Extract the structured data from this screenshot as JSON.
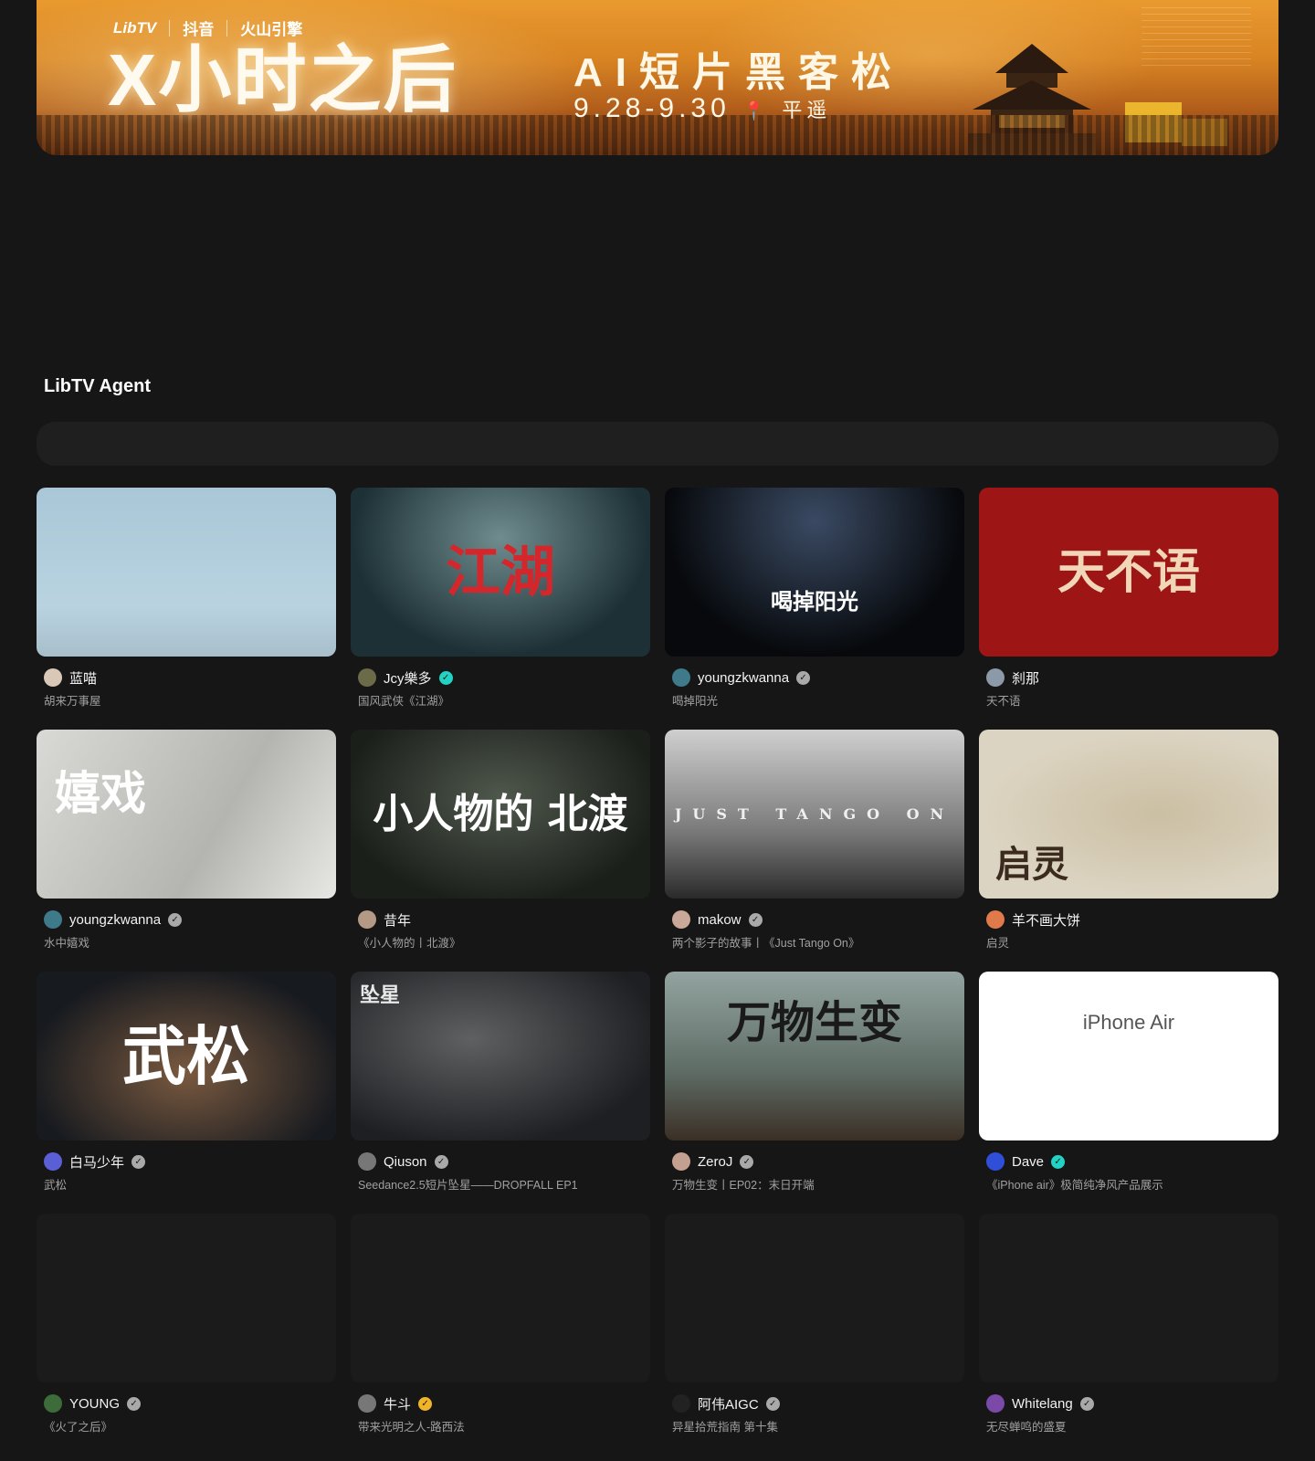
{
  "banner": {
    "brand_libtv": "LibTV",
    "brand_douyin": "抖音",
    "brand_volc": "火山引擎",
    "headline": "X小时之后",
    "subtitle": "AI短片黑客松",
    "dates": "9.28-9.30",
    "location": "平遥"
  },
  "section": {
    "title": "LibTV Agent"
  },
  "cards": [
    {
      "thumb_title": "",
      "user": "蓝喵",
      "badge": "",
      "desc": "胡来万事屋",
      "avatar_color": "#d9c8b8"
    },
    {
      "thumb_title": "江湖",
      "user": "Jcy樂多",
      "badge": "teal",
      "desc": "国风武侠《江湖》",
      "avatar_color": "#6b6b4a"
    },
    {
      "thumb_title": "喝掉阳光",
      "user": "youngzkwanna",
      "badge": "gray",
      "desc": "喝掉阳光",
      "avatar_color": "#3e7a8a"
    },
    {
      "thumb_title": "天不语",
      "user": "刹那",
      "badge": "",
      "desc": "天不语",
      "avatar_color": "#8b99a8"
    },
    {
      "thumb_title": "嬉戏",
      "user": "youngzkwanna",
      "badge": "gray",
      "desc": "水中嬉戏",
      "avatar_color": "#3e7a8a"
    },
    {
      "thumb_title": "小人物的 北渡",
      "user": "昔年",
      "badge": "",
      "desc": "《小人物的丨北渡》",
      "avatar_color": "#b49a86"
    },
    {
      "thumb_title": "JUST TANGO ON",
      "user": "makow",
      "badge": "gray",
      "desc": "两个影子的故事丨《Just Tango On》",
      "avatar_color": "#c9a89a"
    },
    {
      "thumb_title": "启灵",
      "user": "羊不画大饼",
      "badge": "",
      "desc": "启灵",
      "avatar_color": "#e07a4a"
    },
    {
      "thumb_title": "武松",
      "user": "白马少年",
      "badge": "gray",
      "desc": "武松",
      "avatar_color": "#5b5fd6"
    },
    {
      "thumb_title": "坠星",
      "user": "Qiuson",
      "badge": "gray",
      "desc": "Seedance2.5短片坠星——DROPFALL EP1",
      "avatar_color": "#777777"
    },
    {
      "thumb_title": "万物生变",
      "user": "ZeroJ",
      "badge": "gray",
      "desc": "万物生变丨EP02：末日开端",
      "avatar_color": "#c4a090"
    },
    {
      "thumb_title": "iPhone Air",
      "user": "Dave",
      "badge": "teal",
      "desc": "《iPhone air》极简纯净风产品展示",
      "avatar_color": "#2f4fd8"
    },
    {
      "thumb_title": "",
      "user": "YOUNG",
      "badge": "gray",
      "desc": "《火了之后》",
      "avatar_color": "#3d6b3a"
    },
    {
      "thumb_title": "",
      "user": "牛斗",
      "badge": "gold",
      "desc": "带来光明之人-路西法",
      "avatar_color": "#777777"
    },
    {
      "thumb_title": "",
      "user": "阿伟AIGC",
      "badge": "gray",
      "desc": "异星拾荒指南 第十集",
      "avatar_color": "#222222"
    },
    {
      "thumb_title": "",
      "user": "Whitelang",
      "badge": "gray",
      "desc": "无尽蝉鸣的盛夏",
      "avatar_color": "#7b4aa8"
    }
  ]
}
